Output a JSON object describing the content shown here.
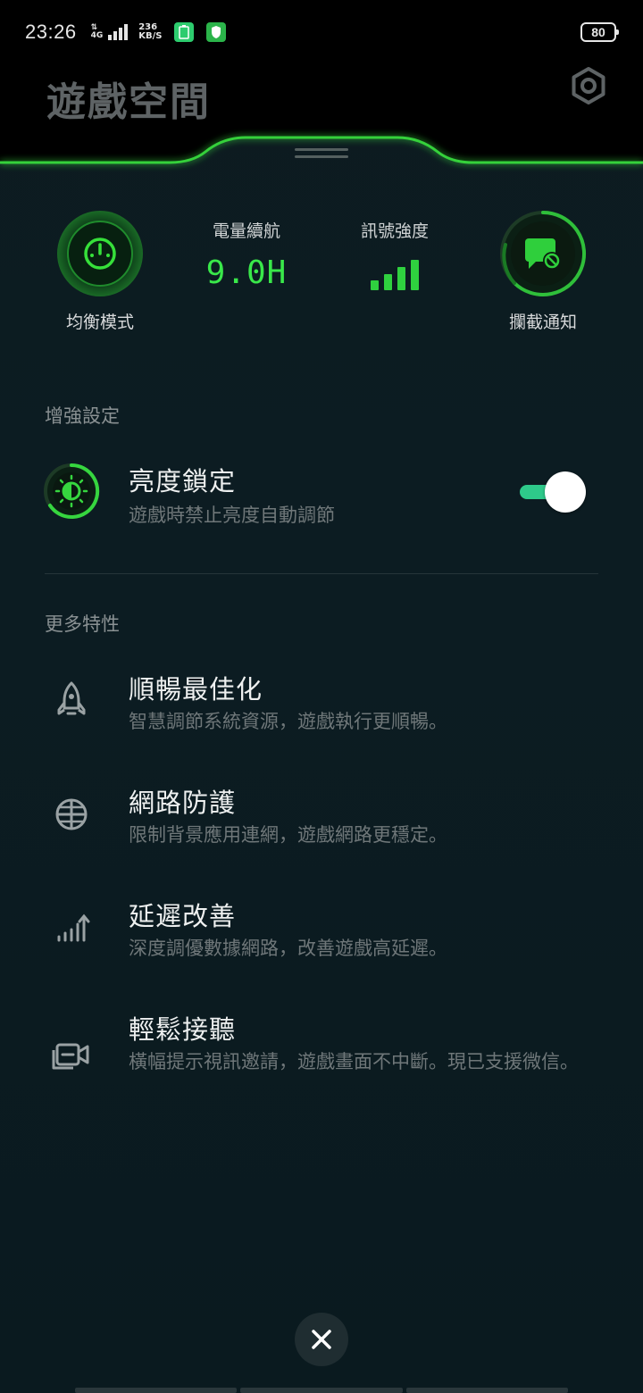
{
  "status_bar": {
    "time": "23:26",
    "net_type": "4G",
    "speed_value": "236",
    "speed_unit": "KB/S",
    "battery": "80"
  },
  "header": {
    "title": "遊戲空間",
    "settings_icon": "gear-icon",
    "accent_color": "#36d13a"
  },
  "stats": {
    "mode_label": "均衡模式",
    "battery_label": "電量續航",
    "battery_value": "9.0H",
    "signal_label": "訊號強度",
    "signal_level": 4,
    "notif_label": "攔截通知"
  },
  "enhanced": {
    "section_title": "增強設定",
    "brightness": {
      "title": "亮度鎖定",
      "desc": "遊戲時禁止亮度自動調節",
      "enabled": true
    }
  },
  "more": {
    "section_title": "更多特性",
    "items": [
      {
        "title": "順暢最佳化",
        "desc": "智慧調節系統資源，遊戲執行更順暢。",
        "icon": "rocket-icon"
      },
      {
        "title": "網路防護",
        "desc": "限制背景應用連網，遊戲網路更穩定。",
        "icon": "globe-icon"
      },
      {
        "title": "延遲改善",
        "desc": "深度調優數據網路，改善遊戲高延遲。",
        "icon": "signal-up-icon"
      },
      {
        "title": "輕鬆接聽",
        "desc": "橫幅提示視訊邀請，遊戲畫面不中斷。現已支援微信。",
        "icon": "video-call-icon"
      }
    ]
  },
  "close_icon": "close-icon"
}
